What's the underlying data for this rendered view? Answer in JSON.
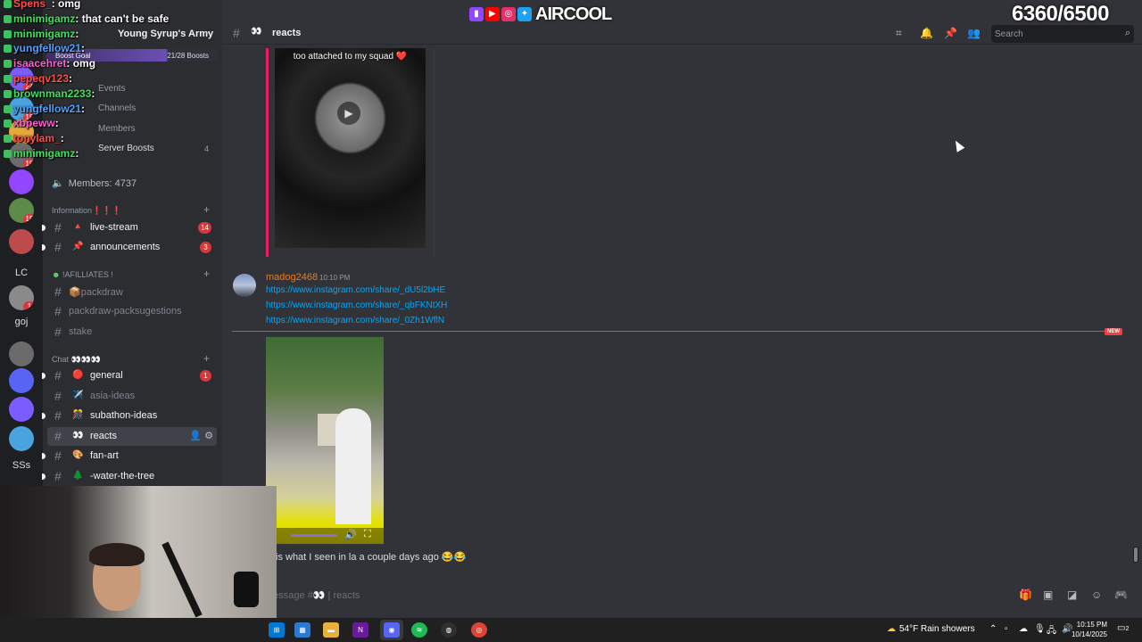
{
  "brand": {
    "name": "AIRCOOL",
    "icons": [
      "twitch-icon",
      "youtube-icon",
      "instagram-icon",
      "twitter-icon"
    ],
    "subs_counter": "6360/6500"
  },
  "stream_chat": [
    {
      "user": "Spens_",
      "msg": "omg",
      "color": "#ff4d4d"
    },
    {
      "user": "minimigamz",
      "msg": "that can't be safe",
      "color": "#3fe05f"
    },
    {
      "user": "minimigamz",
      "msg": "",
      "color": "#3fe05f"
    },
    {
      "user": "yungfellow21",
      "msg": "",
      "color": "#4fa3ff"
    },
    {
      "user": "isaacehret",
      "msg": "omg",
      "color": "#ff5dd2"
    },
    {
      "user": "pepeqv123",
      "msg": "",
      "color": "#ff4d4d"
    },
    {
      "user": "brownman2233",
      "msg": "",
      "color": "#3fe05f"
    },
    {
      "user": "yungfellow21",
      "msg": "",
      "color": "#4fa3ff"
    },
    {
      "user": "xbpeww",
      "msg": "",
      "color": "#ff5dd2"
    },
    {
      "user": "tonylam_",
      "msg": "",
      "color": "#ff4d4d"
    },
    {
      "user": "minimigamz",
      "msg": "",
      "color": "#3fe05f"
    }
  ],
  "servers": [
    {
      "label": "",
      "badge": "24"
    },
    {
      "label": "",
      "badge": "18"
    },
    {
      "label": "",
      "badge": ""
    },
    {
      "label": "",
      "badge": "19"
    },
    {
      "label": "",
      "badge": ""
    },
    {
      "label": "",
      "badge": "15"
    },
    {
      "label": "",
      "badge": ""
    },
    {
      "label": "LC",
      "badge": ""
    },
    {
      "label": "",
      "badge": "1"
    },
    {
      "label": "goj",
      "badge": ""
    },
    {
      "label": "",
      "badge": ""
    },
    {
      "label": "",
      "badge": ""
    },
    {
      "label": "",
      "badge": ""
    },
    {
      "label": "",
      "badge": ""
    },
    {
      "label": "SSs",
      "badge": ""
    }
  ],
  "sidebar": {
    "server_name": "Young Syrup's Army",
    "boost_goal_label": "Boost Goal",
    "boost_count": "21/28 Boosts",
    "links": [
      "Events",
      "Channels",
      "Members",
      "Server Boosts"
    ],
    "server_boosts_count": "4",
    "members_label": "Members: 4737",
    "categories": [
      {
        "name": "Information❗❗❗",
        "channels": [
          {
            "name": "live-stream",
            "emoji": "🔺",
            "badge": "14",
            "unread": true
          },
          {
            "name": "announcements",
            "emoji": "📌",
            "badge": "3",
            "unread": true
          }
        ]
      },
      {
        "name": "!AFILLIATES !",
        "channels": [
          {
            "name": "packdraw",
            "emoji": "📦",
            "badge": "",
            "unread": false
          },
          {
            "name": "packdraw-packsugestions",
            "emoji": "",
            "badge": "",
            "unread": false
          },
          {
            "name": "stake",
            "emoji": "",
            "badge": "",
            "unread": false
          }
        ]
      },
      {
        "name": "Chat 👀👀👀",
        "channels": [
          {
            "name": "general",
            "emoji": "🔴",
            "badge": "1",
            "unread": true
          },
          {
            "name": "asia-ideas",
            "emoji": "✈️",
            "badge": "",
            "unread": false
          },
          {
            "name": "subathon-ideas",
            "emoji": "🎊",
            "badge": "",
            "unread": true
          },
          {
            "name": "reacts",
            "emoji": "👀",
            "badge": "",
            "unread": true,
            "active": true
          },
          {
            "name": "fan-art",
            "emoji": "🎨",
            "badge": "",
            "unread": true
          },
          {
            "name": "-water-the-tree",
            "emoji": "🌲",
            "badge": "",
            "unread": true
          }
        ]
      }
    ]
  },
  "header": {
    "channel_emoji": "👀",
    "channel_name": "reacts",
    "search_placeholder": "Search",
    "icons": [
      "threads-icon",
      "bell-icon",
      "pin-icon",
      "members-icon",
      "search-icon"
    ]
  },
  "messages": {
    "video1_caption": "too attached to my squad ❤️",
    "msg2": {
      "author": "madog2468",
      "time": "10:10 PM",
      "links": [
        "https://www.instagram.com/share/_dU5l2bHE",
        "https://www.instagram.com/share/_qbFKNtXH",
        "https://www.instagram.com/share/_0Zh1WflN"
      ]
    },
    "new_label": "NEW",
    "msg3_text": "is what I seen in la a couple days ago 😂😂"
  },
  "composer": {
    "placeholder": "Message #👀 | reacts"
  },
  "taskbar": {
    "apps": [
      "start-icon",
      "store-icon",
      "folder-icon",
      "nzxt-icon",
      "discord-icon",
      "spotify-icon",
      "obs-icon",
      "chrome-icon"
    ],
    "weather": "54°F  Rain showers",
    "time": "10:15 PM",
    "date": "10/14/2025",
    "notifications": "2"
  }
}
